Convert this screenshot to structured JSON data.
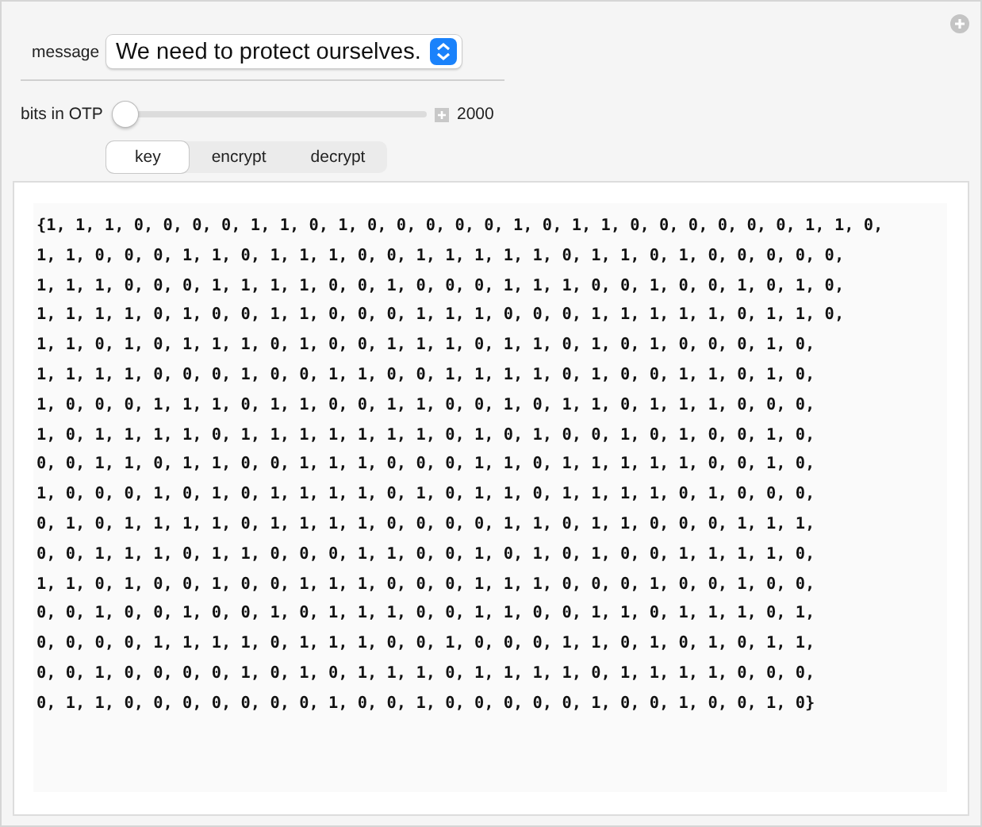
{
  "message": {
    "label": "message",
    "value": "We need to protect ourselves."
  },
  "slider": {
    "label": "bits in OTP",
    "level": 0,
    "reading": "2000"
  },
  "tabs": [
    {
      "label": "key",
      "selected": true
    },
    {
      "label": "encrypt",
      "selected": false
    },
    {
      "label": "decrypt",
      "selected": false
    }
  ],
  "output_lines": [
    "{1, 1, 1, 0, 0, 0, 0, 1, 1, 0, 1, 0, 0, 0, 0, 0, 1, 0, 1, 1, 0, 0, 0, 0, 0, 0, 1, 1, 0,",
    "1, 1, 0, 0, 0, 1, 1, 0, 1, 1, 1, 0, 0, 1, 1, 1, 1, 1, 0, 1, 1, 0, 1, 0, 0, 0, 0, 0,",
    "1, 1, 1, 0, 0, 0, 1, 1, 1, 1, 0, 0, 1, 0, 0, 0, 1, 1, 1, 0, 0, 1, 0, 0, 1, 0, 1, 0,",
    "1, 1, 1, 1, 0, 1, 0, 0, 1, 1, 0, 0, 0, 1, 1, 1, 0, 0, 0, 1, 1, 1, 1, 1, 0, 1, 1, 0,",
    "1, 1, 0, 1, 0, 1, 1, 1, 0, 1, 0, 0, 1, 1, 1, 0, 1, 1, 0, 1, 0, 1, 0, 0, 0, 1, 0,",
    "1, 1, 1, 1, 0, 0, 0, 1, 0, 0, 1, 1, 0, 0, 1, 1, 1, 1, 0, 1, 0, 0, 1, 1, 0, 1, 0,",
    "1, 0, 0, 0, 1, 1, 1, 0, 1, 1, 0, 0, 1, 1, 0, 0, 1, 0, 1, 1, 0, 1, 1, 1, 0, 0, 0,",
    "1, 0, 1, 1, 1, 1, 0, 1, 1, 1, 1, 1, 1, 1, 0, 1, 0, 1, 0, 0, 1, 0, 1, 0, 0, 1, 0,",
    "0, 0, 1, 1, 0, 1, 1, 0, 0, 1, 1, 1, 0, 0, 0, 1, 1, 0, 1, 1, 1, 1, 1, 0, 0, 1, 0,",
    "1, 0, 0, 0, 1, 0, 1, 0, 1, 1, 1, 1, 0, 1, 0, 1, 1, 0, 1, 1, 1, 1, 0, 1, 0, 0, 0,",
    "0, 1, 0, 1, 1, 1, 1, 0, 1, 1, 1, 1, 0, 0, 0, 0, 1, 1, 0, 1, 1, 0, 0, 0, 1, 1, 1,",
    "0, 0, 1, 1, 1, 0, 1, 1, 0, 0, 0, 1, 1, 0, 0, 1, 0, 1, 0, 1, 0, 0, 1, 1, 1, 1, 0,",
    "1, 1, 0, 1, 0, 0, 1, 0, 0, 1, 1, 1, 0, 0, 0, 1, 1, 1, 0, 0, 0, 1, 0, 0, 1, 0, 0,",
    "0, 0, 1, 0, 0, 1, 0, 0, 1, 0, 1, 1, 1, 0, 0, 1, 1, 0, 0, 1, 1, 0, 1, 1, 1, 0, 1,",
    "0, 0, 0, 0, 1, 1, 1, 1, 0, 1, 1, 1, 0, 0, 1, 0, 0, 0, 1, 1, 0, 1, 0, 1, 0, 1, 1,",
    "0, 0, 1, 0, 0, 0, 0, 1, 0, 1, 0, 1, 1, 1, 0, 1, 1, 1, 1, 0, 1, 1, 1, 1, 0, 0, 0,",
    "0, 1, 1, 0, 0, 0, 0, 0, 0, 0, 1, 0, 0, 1, 0, 0, 0, 0, 0, 1, 0, 0, 1, 0, 0, 1, 0}"
  ]
}
